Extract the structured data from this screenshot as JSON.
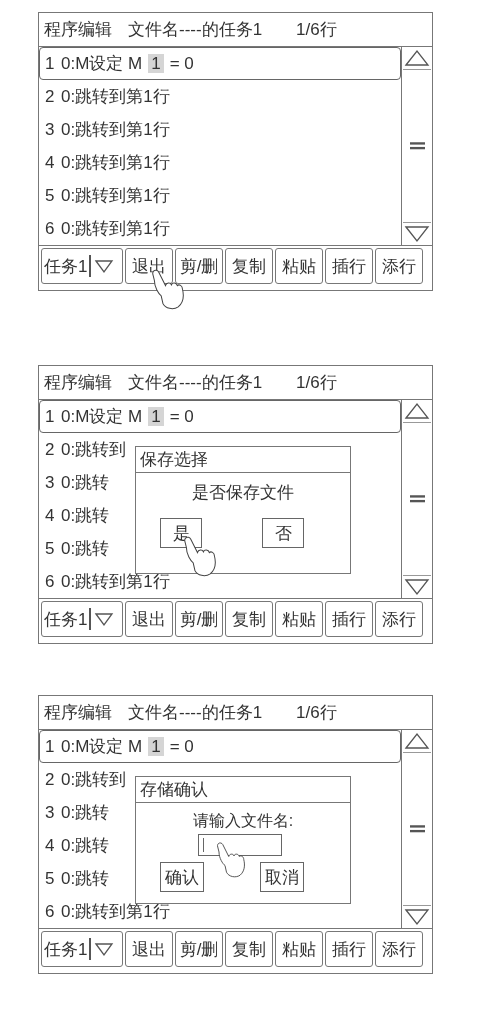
{
  "screens": [
    {
      "title": "程序编辑",
      "file": "文件名----的任务1",
      "position": "1/6行",
      "rows": [
        {
          "number": "1",
          "text": "0:M设定 M",
          "cursor": "1",
          "rest": "= 0",
          "selected": true
        },
        {
          "number": "2",
          "text": "0:跳转到第1行",
          "selected": false
        },
        {
          "number": "3",
          "text": "0:跳转到第1行",
          "selected": false
        },
        {
          "number": "4",
          "text": "0:跳转到第1行",
          "selected": false
        },
        {
          "number": "5",
          "text": "0:跳转到第1行",
          "selected": false
        },
        {
          "number": "6",
          "text": "0:跳转到第1行",
          "selected": false
        }
      ],
      "task": {
        "label": "任务1",
        "pointed": false
      },
      "buttons": [
        {
          "label": "退出",
          "pointed": true
        },
        {
          "label": "剪/删",
          "pointed": false
        },
        {
          "label": "复制",
          "pointed": false
        },
        {
          "label": "粘贴",
          "pointed": false
        },
        {
          "label": "插行",
          "pointed": false
        },
        {
          "label": "添行",
          "pointed": false
        }
      ]
    },
    {
      "title": "程序编辑",
      "file": "文件名----的任务1",
      "position": "1/6行",
      "rows": [
        {
          "number": "1",
          "text": "0:M设定 M",
          "cursor": "1",
          "rest": "= 0",
          "selected": true
        },
        {
          "number": "2",
          "text": "0:跳转到",
          "selected": false
        },
        {
          "number": "3",
          "text": "0:跳转",
          "selected": false
        },
        {
          "number": "4",
          "text": "0:跳转",
          "selected": false
        },
        {
          "number": "5",
          "text": "0:跳转",
          "selected": false
        },
        {
          "number": "6",
          "text": "0:跳转到第1行",
          "selected": false
        }
      ],
      "task": {
        "label": "任务1",
        "pointed": false
      },
      "buttons": [
        {
          "label": "退出",
          "pointed": false
        },
        {
          "label": "剪/删",
          "pointed": false
        },
        {
          "label": "复制",
          "pointed": false
        },
        {
          "label": "粘贴",
          "pointed": false
        },
        {
          "label": "插行",
          "pointed": false
        },
        {
          "label": "添行",
          "pointed": false
        }
      ],
      "dialog": {
        "kind": "confirm",
        "title": "保存选择",
        "message": "是否保存文件",
        "buttons": [
          {
            "label": "是",
            "pointed": true
          },
          {
            "label": "否",
            "pointed": false
          }
        ]
      }
    },
    {
      "title": "程序编辑",
      "file": "文件名----的任务1",
      "position": "1/6行",
      "rows": [
        {
          "number": "1",
          "text": "0:M设定 M",
          "cursor": "1",
          "rest": "= 0",
          "selected": true
        },
        {
          "number": "2",
          "text": "0:跳转到",
          "selected": false
        },
        {
          "number": "3",
          "text": "0:跳转",
          "selected": false
        },
        {
          "number": "4",
          "text": "0:跳转",
          "selected": false
        },
        {
          "number": "5",
          "text": "0:跳转",
          "selected": false
        },
        {
          "number": "6",
          "text": "0:跳转到第1行",
          "selected": false
        }
      ],
      "task": {
        "label": "任务1",
        "pointed": false
      },
      "buttons": [
        {
          "label": "退出",
          "pointed": false
        },
        {
          "label": "剪/删",
          "pointed": false
        },
        {
          "label": "复制",
          "pointed": false
        },
        {
          "label": "粘贴",
          "pointed": false
        },
        {
          "label": "插行",
          "pointed": false
        },
        {
          "label": "添行",
          "pointed": false
        }
      ],
      "dialog": {
        "kind": "input",
        "title": "存储确认",
        "message": "请输入文件名:",
        "field": {
          "pointed": true
        },
        "buttons": [
          {
            "label": "确认",
            "pointed": false
          },
          {
            "label": "取消",
            "pointed": false
          }
        ]
      }
    }
  ]
}
